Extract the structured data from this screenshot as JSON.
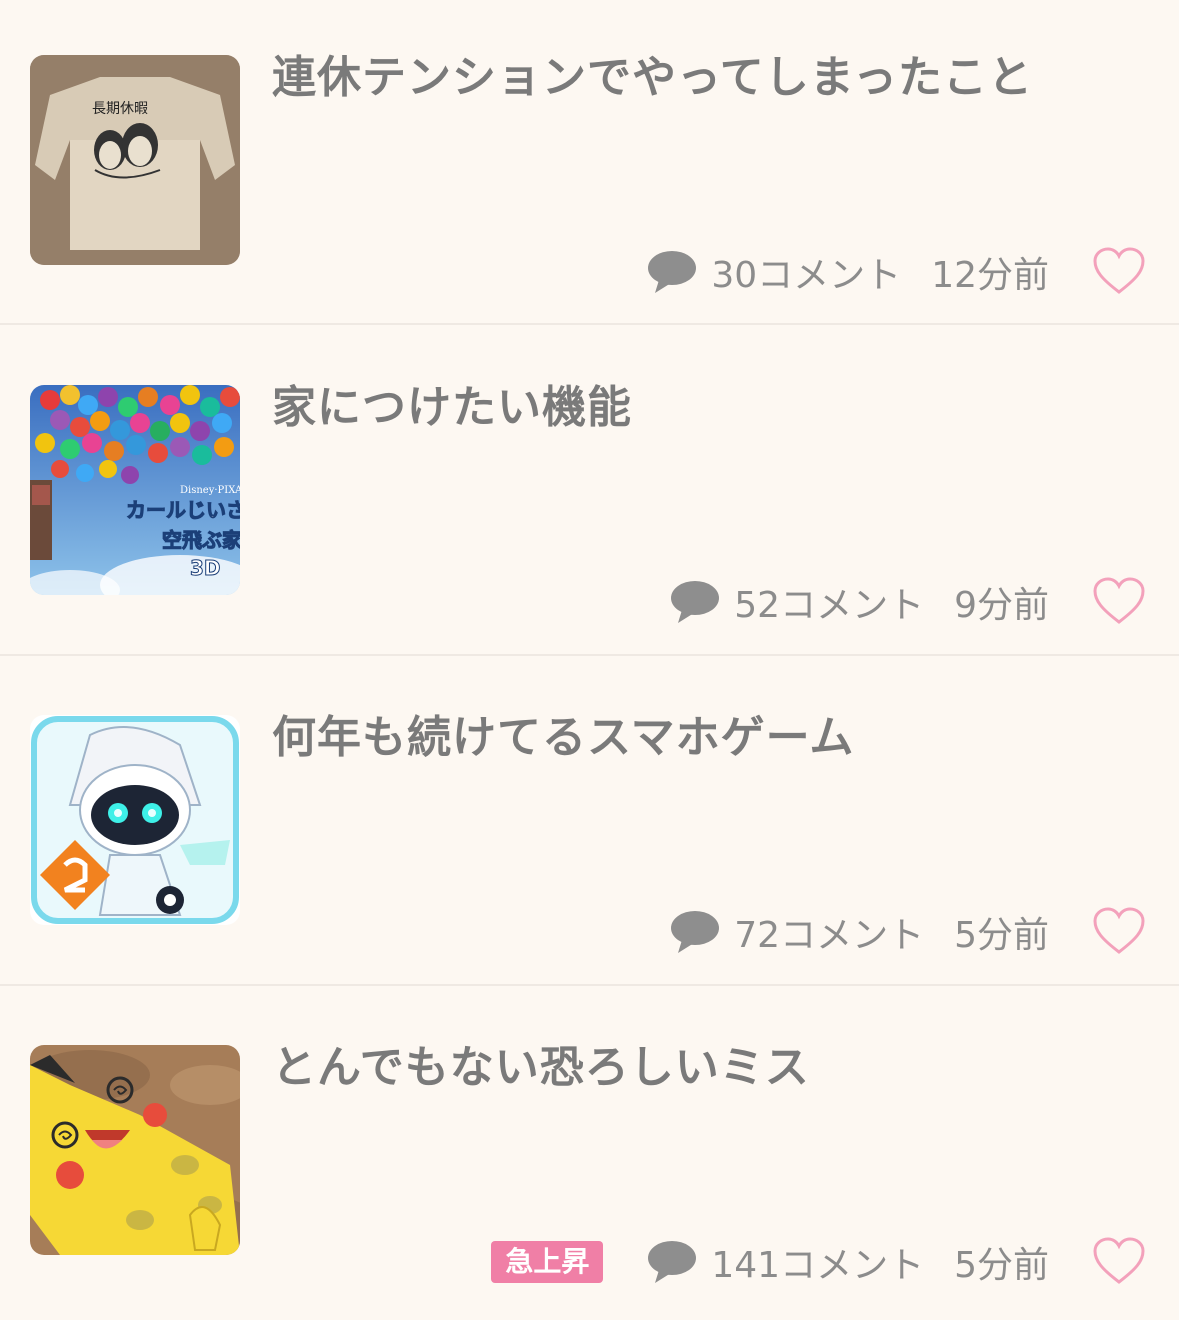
{
  "items": [
    {
      "title": "連休テンションでやってしまったこと",
      "comments": "30コメント",
      "time": "12分前",
      "thumb_icon": "tshirt-thumbnail",
      "thumb_text": "長期休暇"
    },
    {
      "title": "家につけたい機能",
      "comments": "52コメント",
      "time": "9分前",
      "thumb_icon": "balloon-movie-thumbnail",
      "thumb_text_1": "カールじいさ",
      "thumb_text_2": "空飛ぶ家",
      "thumb_text_3": "3D",
      "thumb_text_4": "Disney·PIXAR"
    },
    {
      "title": "何年も続けてるスマホゲーム",
      "comments": "72コメント",
      "time": "5分前",
      "thumb_icon": "game-character-thumbnail"
    },
    {
      "title": "とんでもない恐ろしいミス",
      "comments": "141コメント",
      "time": "5分前",
      "badge": "急上昇",
      "thumb_icon": "pikachu-thumbnail"
    }
  ],
  "colors": {
    "background": "#fdf8f2",
    "title": "#7a7a7a",
    "meta": "#8c8c8c",
    "heart": "#f3a1bb",
    "badge": "#f07fa6"
  }
}
